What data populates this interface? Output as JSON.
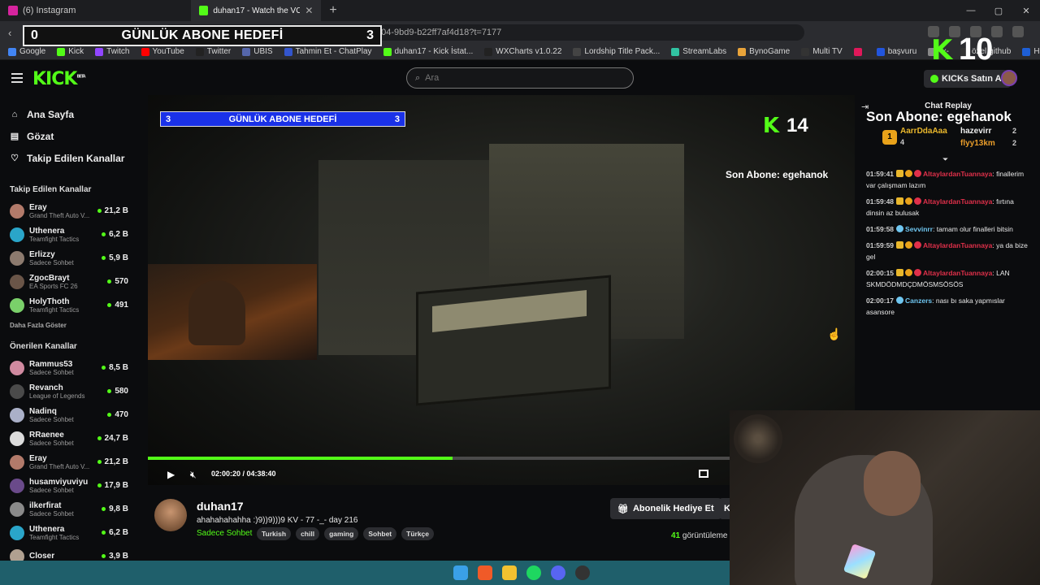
{
  "browser": {
    "tabs": [
      {
        "label": "(6) Instagram",
        "color": "#d6249f",
        "active": false
      },
      {
        "label": "duhan17 - Watch the VOD on Ki",
        "color": "#53fc18",
        "active": true
      }
    ],
    "url": "uhan17/videos/a5eb0ae9-8■4f04-9bd9-b22ff7af4d18?t=7177",
    "bookmarks": [
      {
        "label": "Google",
        "color": "#4285f4"
      },
      {
        "label": "Kick",
        "color": "#53fc18"
      },
      {
        "label": "Twitch",
        "color": "#9146ff"
      },
      {
        "label": "YouTube",
        "color": "#ff0000"
      },
      {
        "label": "Twitter",
        "color": "#222222"
      },
      {
        "label": "UBIS",
        "color": "#5566aa"
      },
      {
        "label": "Tahmin Et - ChatPlay",
        "color": "#3355cc"
      },
      {
        "label": "duhan17 - Kick İstat...",
        "color": "#53fc18"
      },
      {
        "label": "WXCharts v1.0.22",
        "color": "#222222"
      },
      {
        "label": "Lordship Title Pack...",
        "color": "#444444"
      },
      {
        "label": "StreamLabs",
        "color": "#31c3a2"
      },
      {
        "label": "BynoGame",
        "color": "#e8a33a"
      },
      {
        "label": "Multi TV",
        "color": "#333333"
      },
      {
        "label": "",
        "color": "#e0185a"
      },
      {
        "label": "başvuru",
        "color": "#2255dd"
      },
      {
        "label": "-x-",
        "color": "#888888"
      },
      {
        "label": "özel github",
        "color": "#333333"
      },
      {
        "label": "Halka Arz Takvi",
        "color": "#1e5fd6"
      }
    ]
  },
  "overlay_top": {
    "left_count": "0",
    "goal_title": "GÜNLÜK ABONE HEDEFİ",
    "right_count": "3",
    "kicks": "10"
  },
  "header": {
    "logo": "KICK",
    "logo_sup": "BETA",
    "search_placeholder": "Ara",
    "buy_label": "KICKs Satın Al"
  },
  "sidebar": {
    "nav": [
      {
        "icon": "⌂",
        "label": "Ana Sayfa"
      },
      {
        "icon": "▤",
        "label": "Gözat"
      },
      {
        "icon": "♡",
        "label": "Takip Edilen Kanallar"
      }
    ],
    "followed_title": "Takip Edilen Kanallar",
    "followed": [
      {
        "name": "Eray",
        "category": "Grand Theft Auto V...",
        "viewers": "21,2 B",
        "color": "#b27a6a"
      },
      {
        "name": "Uthenera",
        "category": "Teamfight Tactics",
        "viewers": "6,2 B",
        "color": "#2aa5c9"
      },
      {
        "name": "Erlizzy",
        "category": "Sadece Sohbet",
        "viewers": "5,9 B",
        "color": "#8c7a6e"
      },
      {
        "name": "ZgocBrayt",
        "category": "EA Sports FC 26",
        "viewers": "570",
        "color": "#6a5548"
      },
      {
        "name": "HolyThoth",
        "category": "Teamfight Tactics",
        "viewers": "491",
        "color": "#7ad06a"
      }
    ],
    "more_label": "Daha Fazla Göster",
    "recommended_title": "Önerilen Kanallar",
    "recommended": [
      {
        "name": "Rammus53",
        "category": "Sadece Sohbet",
        "viewers": "8,5 B",
        "color": "#d08aa0"
      },
      {
        "name": "Revanch",
        "category": "League of Legends",
        "viewers": "580",
        "color": "#4a4a4a"
      },
      {
        "name": "Nadinq",
        "category": "Sadece Sohbet",
        "viewers": "470",
        "color": "#aab0c8"
      },
      {
        "name": "RRaenee",
        "category": "Sadece Sohbet",
        "viewers": "24,7 B",
        "color": "#dcdcdc"
      },
      {
        "name": "Eray",
        "category": "Grand Theft Auto V...",
        "viewers": "21,2 B",
        "color": "#b27a6a"
      },
      {
        "name": "husamviyuviyu",
        "category": "Sadece Sohbet",
        "viewers": "17,9 B",
        "color": "#6a4a8a"
      },
      {
        "name": "ilkerfirat",
        "category": "Sadece Sohbet",
        "viewers": "9,8 B",
        "color": "#8a8a8a"
      },
      {
        "name": "Uthenera",
        "category": "Teamfight Tactics",
        "viewers": "6,2 B",
        "color": "#2aa5c9"
      },
      {
        "name": "Closer",
        "category": "",
        "viewers": "3,9 B",
        "color": "#b0a090"
      }
    ]
  },
  "video": {
    "goal_left": "3",
    "goal_title": "GÜNLÜK ABONE HEDEFİ",
    "goal_right": "3",
    "kicks": "14",
    "last_sub": "Son Abone: egehanok",
    "time": "02:00:20 / 04:38:40",
    "progress_fraction": 0.4311
  },
  "chat": {
    "header": "Chat Replay",
    "sub_overlay": "Son Abone: egehanok",
    "leaderboard": {
      "first": "AarrDdaAaa",
      "first_count": "4",
      "second": "hazevirr",
      "second_count": "2",
      "third": "flyy13km",
      "third_count": "2",
      "medal": "1"
    },
    "messages": [
      {
        "time": "01:59:41",
        "user": "AltaylardanTuannaya",
        "color": "#e0304a",
        "text": "finallerim var çalışmam lazım",
        "badges": true
      },
      {
        "time": "01:59:48",
        "user": "AltaylardanTuannaya",
        "color": "#e0304a",
        "text": "fırtına dinsin az bulusak",
        "badges": true
      },
      {
        "time": "01:59:58",
        "user": "Sevvinrr",
        "color": "#6fc6f0",
        "text": "tamam olur finalleri bitsin",
        "badges": false
      },
      {
        "time": "01:59:59",
        "user": "AltaylardanTuannaya",
        "color": "#e0304a",
        "text": "ya da bize gel",
        "badges": true
      },
      {
        "time": "02:00:15",
        "user": "AltaylardanTuannaya",
        "color": "#e0304a",
        "text": "LAN SKMDÖDMDÇDMÖSMSÖSÖS",
        "badges": true
      },
      {
        "time": "02:00:17",
        "user": "Canzers",
        "color": "#6fc6f0",
        "text": "nası bı saka yapmıslar asansore",
        "badges": false
      }
    ]
  },
  "channel": {
    "name": "duhan17",
    "title": "ahahahahahha :)9))9)))9 KV - 77 -_-  day 216",
    "category": "Sadece Sohbet",
    "tags": [
      "Turkish",
      "chill",
      "gaming",
      "Sohbet",
      "Türkçe"
    ],
    "gift_label": "Abonelik Hediye Et",
    "k_label": "K",
    "views_count": "41",
    "views_label": "görüntüleme"
  },
  "colors": {
    "accent": "#53fc18",
    "goal_bar": "#1a31e8",
    "taskbar": "#1f5f6b"
  }
}
